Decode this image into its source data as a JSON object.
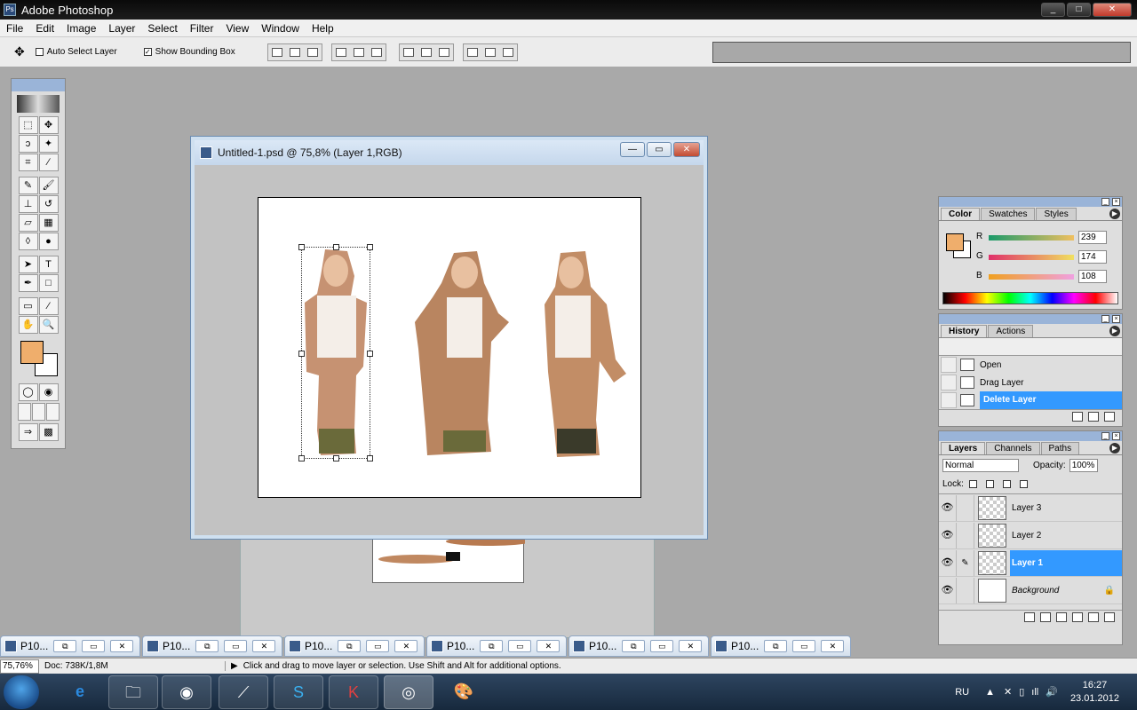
{
  "app": {
    "title": "Adobe Photoshop",
    "win_min": "_",
    "win_max": "□",
    "win_close": "✕"
  },
  "menu": [
    "File",
    "Edit",
    "Image",
    "Layer",
    "Select",
    "Filter",
    "View",
    "Window",
    "Help"
  ],
  "options": {
    "auto_select": "Auto Select Layer",
    "auto_select_checked": false,
    "show_bbox": "Show Bounding Box",
    "show_bbox_checked": true
  },
  "document": {
    "title": "Untitled-1.psd @ 75,8% (Layer 1,RGB)"
  },
  "color_panel": {
    "tabs": [
      "Color",
      "Swatches",
      "Styles"
    ],
    "r_label": "R",
    "g_label": "G",
    "b_label": "B",
    "r": "239",
    "g": "174",
    "b": "108",
    "fg_color": "#efae6c"
  },
  "history_panel": {
    "tabs": [
      "History",
      "Actions"
    ],
    "items": [
      "Open",
      "Drag Layer",
      "Delete Layer"
    ],
    "selected": "Delete Layer"
  },
  "layers_panel": {
    "tabs": [
      "Layers",
      "Channels",
      "Paths"
    ],
    "blend_mode": "Normal",
    "opacity_label": "Opacity:",
    "opacity": "100%",
    "lock_label": "Lock:",
    "layers": [
      "Layer 3",
      "Layer 2",
      "Layer 1",
      "Background"
    ],
    "selected": "Layer 1"
  },
  "minimized_docs": [
    "P10...",
    "P10...",
    "P10...",
    "P10...",
    "P10...",
    "P10..."
  ],
  "status": {
    "zoom": "75,76%",
    "doc": "Doc: 738K/1,8M",
    "message": "Click and drag to move layer or selection.  Use Shift and Alt for additional options."
  },
  "taskbar": {
    "lang": "RU",
    "time": "16:27",
    "date": "23.01.2012"
  }
}
